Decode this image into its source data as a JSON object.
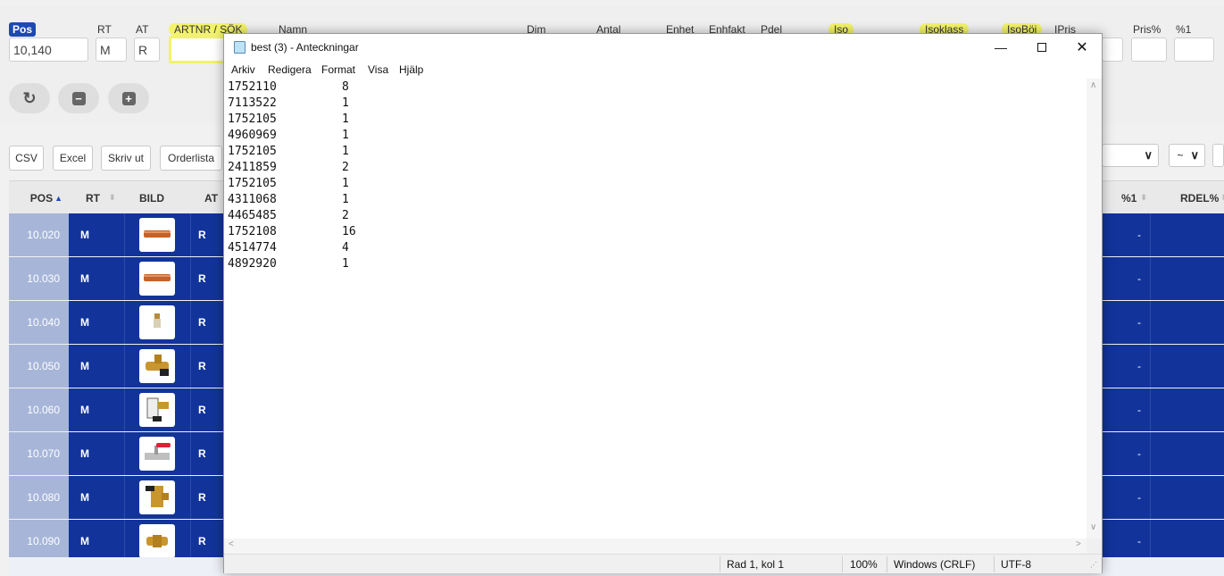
{
  "form": {
    "pos_label": "Pos",
    "pos_value": "10,140",
    "rt_label": "RT",
    "rt_value": "M",
    "at_label": "AT",
    "at_value": "R",
    "artnr_label": "ARTNR / SÖK",
    "namn_label": "Namn",
    "dim_label": "Dim",
    "antal_label": "Antal",
    "enhet_label": "Enhet",
    "enhfakt_label": "Enhfakt",
    "pdel_label": "Pdel",
    "iso_label": "Iso",
    "isoklass_label": "Isoklass",
    "isoboj_label": "IsoBöj",
    "ipris_label": "IPris",
    "prisproc_label": "Pris%",
    "pct1_label": "%1"
  },
  "toolbar": {
    "csv": "CSV",
    "excel": "Excel",
    "print": "Skriv ut",
    "orderlist": "Orderlista",
    "sort_select": "~"
  },
  "table": {
    "columns": [
      "POS",
      "RT",
      "BILD",
      "AT",
      "%1",
      "RDEL%"
    ],
    "rows": [
      {
        "pos": "10.020",
        "rt": "M",
        "at": "R",
        "pct1": "-",
        "icon": "copper-pipe-icon"
      },
      {
        "pos": "10.030",
        "rt": "M",
        "at": "R",
        "pct1": "-",
        "icon": "copper-pipe-icon"
      },
      {
        "pos": "10.040",
        "rt": "M",
        "at": "R",
        "pct1": "-",
        "icon": "valve-small-icon"
      },
      {
        "pos": "10.050",
        "rt": "M",
        "at": "R",
        "pct1": "-",
        "icon": "brass-valve-icon"
      },
      {
        "pos": "10.060",
        "rt": "M",
        "at": "R",
        "pct1": "-",
        "icon": "thermostat-valve-icon"
      },
      {
        "pos": "10.070",
        "rt": "M",
        "at": "R",
        "pct1": "-",
        "icon": "ball-valve-icon"
      },
      {
        "pos": "10.080",
        "rt": "M",
        "at": "R",
        "pct1": "-",
        "icon": "angle-valve-icon"
      },
      {
        "pos": "10.090",
        "rt": "M",
        "at": "R",
        "pct1": "-",
        "icon": "brass-fitting-icon"
      }
    ]
  },
  "notepad": {
    "title": "best (3) - Anteckningar",
    "menu": [
      "Arkiv",
      "Redigera",
      "Format",
      "Visa",
      "Hjälp"
    ],
    "lines": [
      {
        "art": "1752110",
        "qty": "8"
      },
      {
        "art": "7113522",
        "qty": "1"
      },
      {
        "art": "1752105",
        "qty": "1"
      },
      {
        "art": "4960969",
        "qty": "1"
      },
      {
        "art": "1752105",
        "qty": "1"
      },
      {
        "art": "2411859",
        "qty": "2"
      },
      {
        "art": "1752105",
        "qty": "1"
      },
      {
        "art": "4311068",
        "qty": "1"
      },
      {
        "art": "4465485",
        "qty": "2"
      },
      {
        "art": "1752108",
        "qty": "16"
      },
      {
        "art": "4514774",
        "qty": "4"
      },
      {
        "art": "4892920",
        "qty": "1"
      }
    ],
    "status": {
      "position": "Rad 1, kol 1",
      "zoom": "100%",
      "line_ending": "Windows (CRLF)",
      "encoding": "UTF-8"
    }
  },
  "colors": {
    "row_blue": "#12349a",
    "pos_cell": "#a7b6d8",
    "highlight_yellow": "#f3f36a",
    "pos_badge": "#1d49b5"
  }
}
